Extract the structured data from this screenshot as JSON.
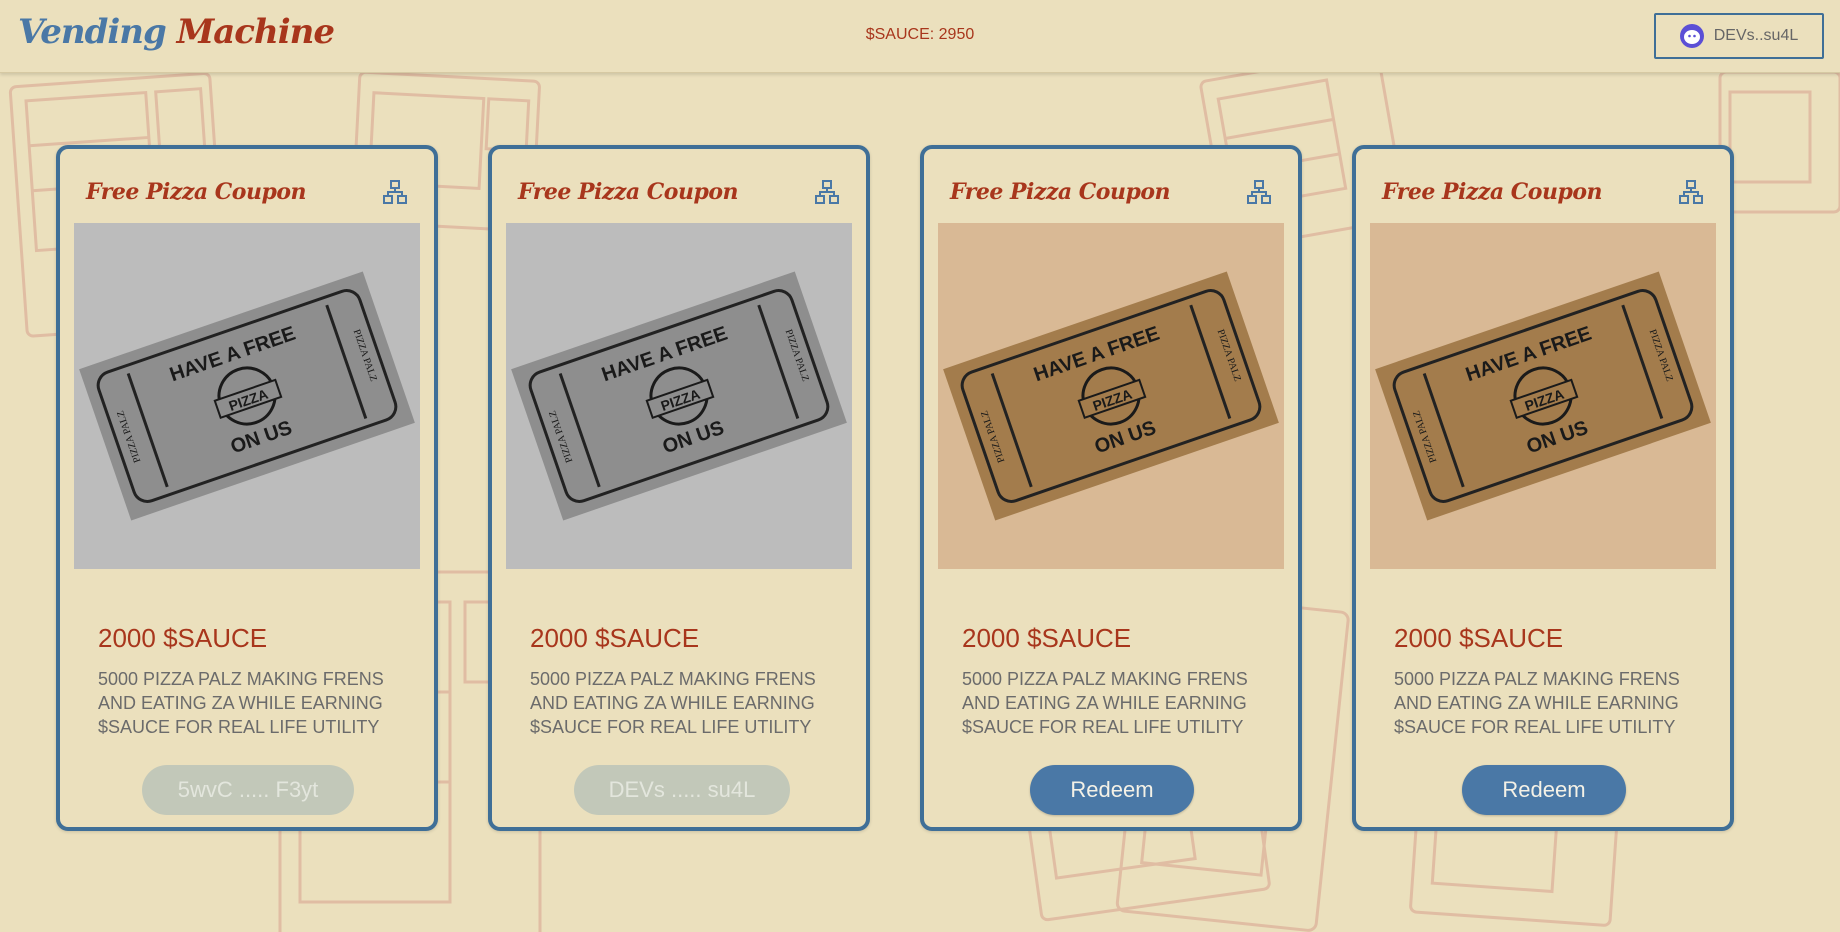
{
  "header": {
    "logo_word1": "Vending",
    "logo_word2": "Machine",
    "balance": "$SAUCE: 2950",
    "wallet_label": "DEVs..su4L"
  },
  "ticket_text": {
    "top": "HAVE A FREE",
    "badge": "PIZZA",
    "bottom": "ON US",
    "side": "PIZZA PALZ"
  },
  "cards": [
    {
      "title": "Free Pizza Coupon",
      "price": "2000 $SAUCE",
      "description": "5000 PIZZA PALZ MAKING FRENS AND EATING ZA WHILE EARNING $SAUCE FOR REAL LIFE UTILITY",
      "button_label": "5wvC ..... F3yt",
      "button_state": "disabled",
      "image_style": "gray"
    },
    {
      "title": "Free Pizza Coupon",
      "price": "2000 $SAUCE",
      "description": "5000 PIZZA PALZ MAKING FRENS AND EATING ZA WHILE EARNING $SAUCE FOR REAL LIFE UTILITY",
      "button_label": "DEVs ..... su4L",
      "button_state": "disabled",
      "image_style": "gray"
    },
    {
      "title": "Free Pizza Coupon",
      "price": "2000 $SAUCE",
      "description": "5000 PIZZA PALZ MAKING FRENS AND EATING ZA WHILE EARNING $SAUCE FOR REAL LIFE UTILITY",
      "button_label": "Redeem",
      "button_state": "active",
      "image_style": "tan"
    },
    {
      "title": "Free Pizza Coupon",
      "price": "2000 $SAUCE",
      "description": "5000 PIZZA PALZ MAKING FRENS AND EATING ZA WHILE EARNING $SAUCE FOR REAL LIFE UTILITY",
      "button_label": "Redeem",
      "button_state": "active",
      "image_style": "tan"
    }
  ],
  "colors": {
    "background": "#ebe0bd",
    "accent_blue": "#4a78a6",
    "accent_red": "#a8361c",
    "disabled_button": "#c2c8b9"
  },
  "icons": {
    "card_corner": "network-icon",
    "wallet": "wallet-avatar-icon"
  }
}
